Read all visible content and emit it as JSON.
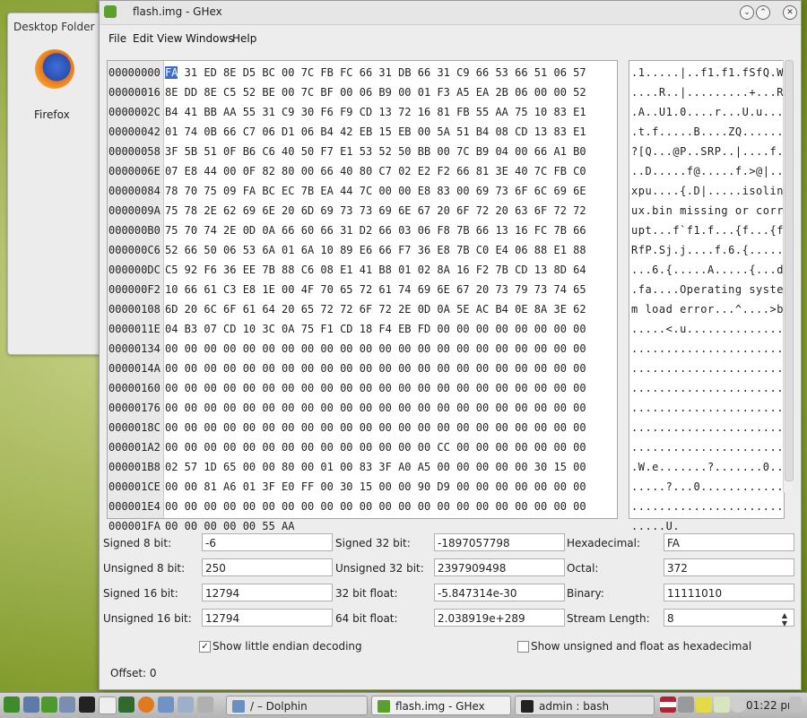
{
  "desktop": {
    "folder_title": "Desktop Folder",
    "firefox_label": "Firefox"
  },
  "window": {
    "title": "flash.img - GHex",
    "buttons": [
      "chevron-down",
      "chevron-up",
      "close"
    ]
  },
  "menu": [
    "File",
    "Edit",
    "View",
    "Windows",
    "Help"
  ],
  "hex": {
    "offsets": [
      "00000000",
      "00000016",
      "0000002C",
      "00000042",
      "00000058",
      "0000006E",
      "00000084",
      "0000009A",
      "000000B0",
      "000000C6",
      "000000DC",
      "000000F2",
      "00000108",
      "0000011E",
      "00000134",
      "0000014A",
      "00000160",
      "00000176",
      "0000018C",
      "000001A2",
      "000001B8",
      "000001CE",
      "000001E4",
      "000001FA"
    ],
    "cursor_byte": "FA",
    "rows": [
      " 31 ED 8E D5 BC 00 7C FB FC 66 31 DB 66 31 C9 66 53 66 51 06 57",
      "8E DD 8E C5 52 BE 00 7C BF 00 06 B9 00 01 F3 A5 EA 2B 06 00 00 52",
      "B4 41 BB AA 55 31 C9 30 F6 F9 CD 13 72 16 81 FB 55 AA 75 10 83 E1",
      "01 74 0B 66 C7 06 D1 06 B4 42 EB 15 EB 00 5A 51 B4 08 CD 13 83 E1",
      "3F 5B 51 0F B6 C6 40 50 F7 E1 53 52 50 BB 00 7C B9 04 00 66 A1 B0",
      "07 E8 44 00 0F 82 80 00 66 40 80 C7 02 E2 F2 66 81 3E 40 7C FB C0",
      "78 70 75 09 FA BC EC 7B EA 44 7C 00 00 E8 83 00 69 73 6F 6C 69 6E",
      "75 78 2E 62 69 6E 20 6D 69 73 73 69 6E 67 20 6F 72 20 63 6F 72 72",
      "75 70 74 2E 0D 0A 66 60 66 31 D2 66 03 06 F8 7B 66 13 16 FC 7B 66",
      "52 66 50 06 53 6A 01 6A 10 89 E6 66 F7 36 E8 7B C0 E4 06 88 E1 88",
      "C5 92 F6 36 EE 7B 88 C6 08 E1 41 B8 01 02 8A 16 F2 7B CD 13 8D 64",
      "10 66 61 C3 E8 1E 00 4F 70 65 72 61 74 69 6E 67 20 73 79 73 74 65",
      "6D 20 6C 6F 61 64 20 65 72 72 6F 72 2E 0D 0A 5E AC B4 0E 8A 3E 62",
      "04 B3 07 CD 10 3C 0A 75 F1 CD 18 F4 EB FD 00 00 00 00 00 00 00 00",
      "00 00 00 00 00 00 00 00 00 00 00 00 00 00 00 00 00 00 00 00 00 00",
      "00 00 00 00 00 00 00 00 00 00 00 00 00 00 00 00 00 00 00 00 00 00",
      "00 00 00 00 00 00 00 00 00 00 00 00 00 00 00 00 00 00 00 00 00 00",
      "00 00 00 00 00 00 00 00 00 00 00 00 00 00 00 00 00 00 00 00 00 00",
      "00 00 00 00 00 00 00 00 00 00 00 00 00 00 00 00 00 00 00 00 00 00",
      "00 00 00 00 00 00 00 00 00 00 00 00 00 00 CC 00 00 00 00 00 00 00",
      "02 57 1D 65 00 00 80 00 01 00 83 3F A0 A5 00 00 00 00 00 30 15 00",
      "00 00 81 A6 01 3F E0 FF 00 30 15 00 00 90 D9 00 00 00 00 00 00 00",
      "00 00 00 00 00 00 00 00 00 00 00 00 00 00 00 00 00 00 00 00 00 00",
      "00 00 00 00 00 55 AA"
    ],
    "ascii": [
      ".1.....|..f1.f1.fSfQ.W",
      "....R..|.........+...R",
      ".A..U1.0....r...U.u...",
      ".t.f.....B....ZQ......",
      "?[Q...@P..SRP..|....f.",
      "..D.....f@.....f.>@|..",
      "xpu....{.D|.....isolin",
      "ux.bin missing or corr",
      "upt...f`f1.f...{f...{f",
      "RfP.Sj.j....f.6.{.....",
      "...6.{.....A.....{...d",
      ".fa....Operating syste",
      "m load error...^....>b",
      ".....<.u..............",
      "......................",
      "......................",
      "......................",
      "......................",
      "......................",
      "......................",
      ".W.e.......?.......0..",
      ".....?...0............",
      "......................",
      ".....U."
    ]
  },
  "values": {
    "signed8_label": "Signed 8 bit:",
    "signed8": "-6",
    "unsigned8_label": "Unsigned 8 bit:",
    "unsigned8": "250",
    "signed16_label": "Signed 16 bit:",
    "signed16": "12794",
    "unsigned16_label": "Unsigned 16 bit:",
    "unsigned16": "12794",
    "signed32_label": "Signed 32 bit:",
    "signed32": "-1897057798",
    "unsigned32_label": "Unsigned 32 bit:",
    "unsigned32": "2397909498",
    "float32_label": "32 bit float:",
    "float32": "-5.847314e-30",
    "float64_label": "64 bit float:",
    "float64": "2.038919e+289",
    "hex_label": "Hexadecimal:",
    "hex": "FA",
    "octal_label": "Octal:",
    "octal": "372",
    "binary_label": "Binary:",
    "binary": "11111010",
    "stream_label": "Stream Length:",
    "stream": "8",
    "little_endian_label": "Show little endian decoding",
    "little_endian_checked": true,
    "unsigned_hex_label": "Show unsigned and float as hexadecimal",
    "unsigned_hex_checked": false
  },
  "status": {
    "offset": "Offset: 0"
  },
  "taskbar": {
    "tasks": [
      "/ – Dolphin",
      "flash.img - GHex",
      "admin : bash"
    ],
    "clock": "01:22 pm"
  }
}
